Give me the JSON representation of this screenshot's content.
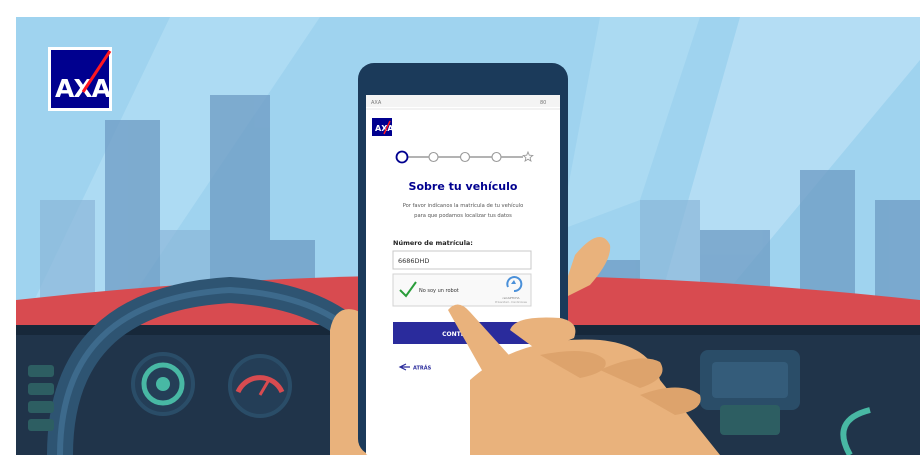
{
  "brand": {
    "logo_text": "AXA",
    "color_blue": "#00008f",
    "color_red": "#ff1721"
  },
  "phone": {
    "status_bar": {
      "carrier": "AXA",
      "battery": "80"
    },
    "app_logo_text": "AXA",
    "progress": {
      "total_steps": 5,
      "current_step": 1
    },
    "title": "Sobre tu vehículo",
    "subtitle_line1": "Por favor indícanos la matrícula de tu vehículo",
    "subtitle_line2": "para que podamos localizar tus datos",
    "field_label": "Número de matrícula:",
    "field_value": "6686DHD",
    "captcha": {
      "label": "No soy un robot",
      "brand": "reCAPTCHA",
      "links": "Privacidad - Condiciones"
    },
    "continue_label": "CONTINUAR",
    "back_label": "ATRÁS"
  },
  "colors": {
    "sky": "#9dd2ee",
    "dashboard_red": "#d94a4f",
    "dashboard_dark": "#1f3144",
    "skin": "#e9b27c",
    "button_blue": "#2a2b9c"
  }
}
